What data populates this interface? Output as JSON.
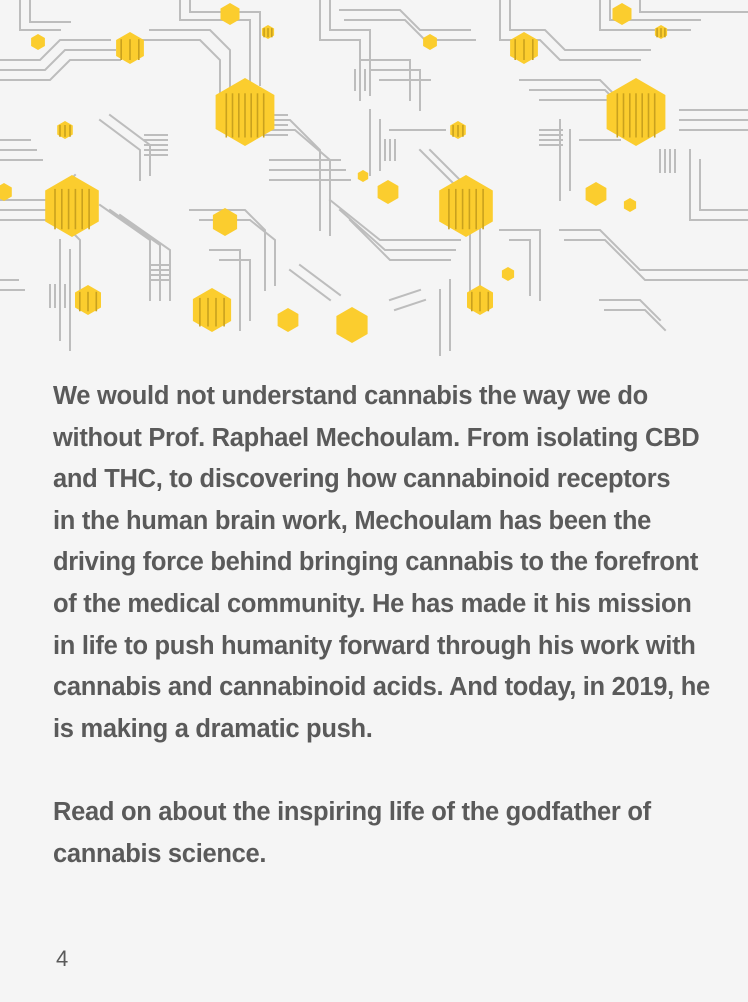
{
  "colors": {
    "background": "#f5f5f5",
    "text": "#5a5a5a",
    "hexagon_accent": "#fbcd2e",
    "line_art": "#bdbdbd"
  },
  "illustration": {
    "icon": "molecular-hexagon-network-icon"
  },
  "content": {
    "paragraph_1": "We would not understand cannabis the way we do without Prof. Raphael Mechoulam. From isolating CBD and THC, to discovering how cannabinoid receptors\nin the human brain work, Mechoulam has been the driving force behind bringing cannabis to the forefront of the medical community. He has made it his mission in life to push humanity forward through his work with cannabis and cannabinoid acids. And today, in 2019, he is making a dramatic push.",
    "paragraph_2": "Read on about the inspiring life of the godfather of cannabis science."
  },
  "footer": {
    "page_number": "4"
  }
}
